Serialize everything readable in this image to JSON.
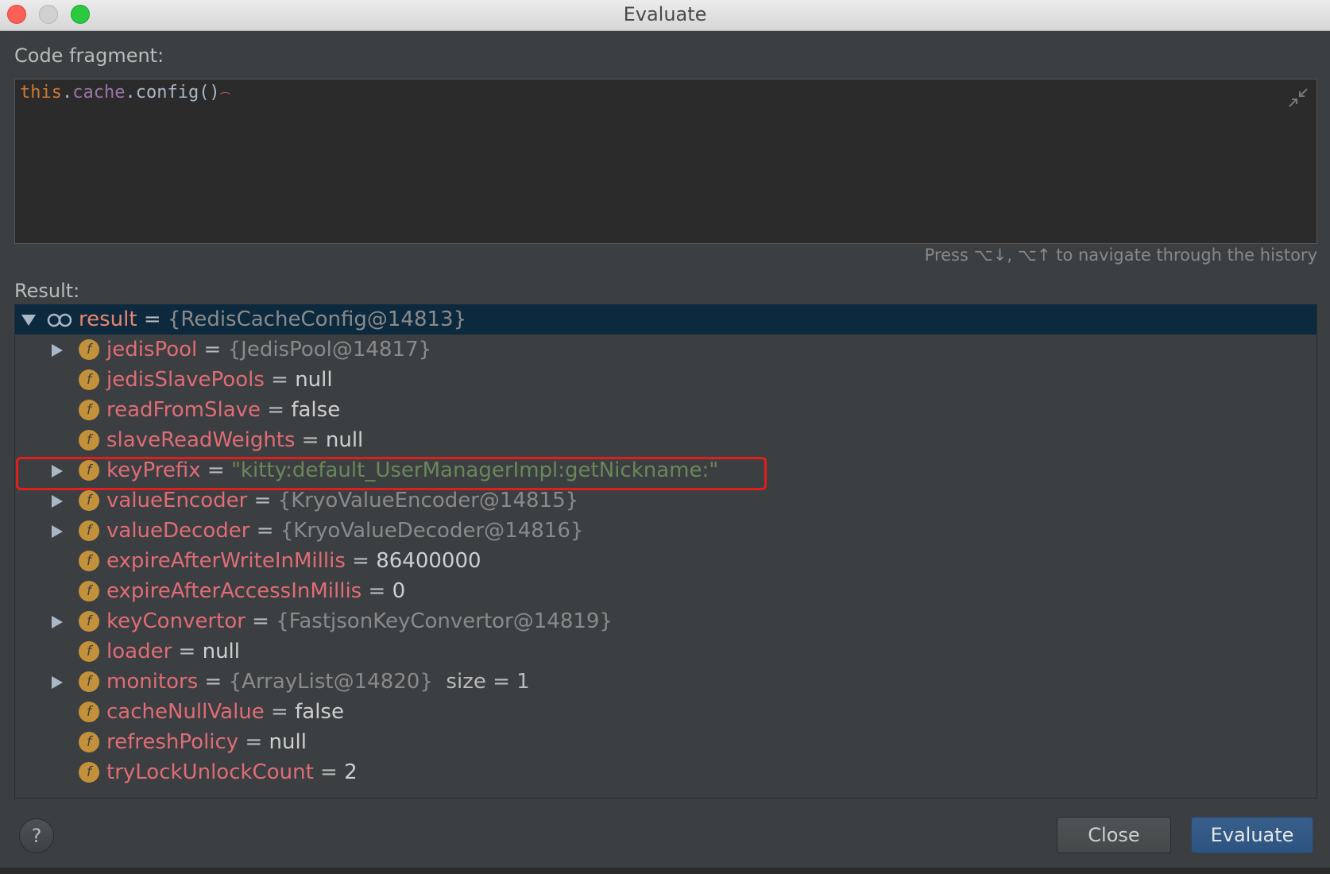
{
  "window": {
    "title": "Evaluate"
  },
  "code_fragment": {
    "label": "Code fragment:",
    "code_this": "this",
    "code_dot1": ".",
    "code_field": "cache",
    "code_dot2": ".",
    "code_method": "config()",
    "history_hint": "Press ⌥↓, ⌥↑ to navigate through the history"
  },
  "result": {
    "label": "Result:",
    "root": {
      "name": "result",
      "eq": " = ",
      "value": "{RedisCacheConfig@14813}"
    },
    "fields": [
      {
        "name": "jedisPool",
        "eq": " = ",
        "value": "{JedisPool@14817}",
        "expandable": true,
        "kind": "ref"
      },
      {
        "name": "jedisSlavePools",
        "eq": " = ",
        "value": "null",
        "expandable": false,
        "kind": "val"
      },
      {
        "name": "readFromSlave",
        "eq": " = ",
        "value": "false",
        "expandable": false,
        "kind": "val"
      },
      {
        "name": "slaveReadWeights",
        "eq": " = ",
        "value": "null",
        "expandable": false,
        "kind": "val"
      },
      {
        "name": "keyPrefix",
        "eq": " = ",
        "value": "\"kitty:default_UserManagerImpl:getNickname:\"",
        "expandable": true,
        "kind": "str"
      },
      {
        "name": "valueEncoder",
        "eq": " = ",
        "value": "{KryoValueEncoder@14815}",
        "expandable": true,
        "kind": "ref"
      },
      {
        "name": "valueDecoder",
        "eq": " = ",
        "value": "{KryoValueDecoder@14816}",
        "expandable": true,
        "kind": "ref"
      },
      {
        "name": "expireAfterWriteInMillis",
        "eq": " = ",
        "value": "86400000",
        "expandable": false,
        "kind": "val"
      },
      {
        "name": "expireAfterAccessInMillis",
        "eq": " = ",
        "value": "0",
        "expandable": false,
        "kind": "val"
      },
      {
        "name": "keyConvertor",
        "eq": " = ",
        "value": "{FastjsonKeyConvertor@14819}",
        "expandable": true,
        "kind": "ref"
      },
      {
        "name": "loader",
        "eq": " = ",
        "value": "null",
        "expandable": false,
        "kind": "val"
      },
      {
        "name": "monitors",
        "eq": " = ",
        "value": "{ArrayList@14820}",
        "extra": "  size = 1",
        "expandable": true,
        "kind": "ref"
      },
      {
        "name": "cacheNullValue",
        "eq": " = ",
        "value": "false",
        "expandable": false,
        "kind": "val"
      },
      {
        "name": "refreshPolicy",
        "eq": " = ",
        "value": "null",
        "expandable": false,
        "kind": "val"
      },
      {
        "name": "tryLockUnlockCount",
        "eq": " = ",
        "value": "2",
        "expandable": false,
        "kind": "val"
      }
    ],
    "field_icon_letter": "f"
  },
  "buttons": {
    "help": "?",
    "close": "Close",
    "evaluate": "Evaluate"
  },
  "colors": {
    "highlight_box": "#e01e1e",
    "selection": "#0d293e",
    "field_icon": "#c4913b"
  }
}
